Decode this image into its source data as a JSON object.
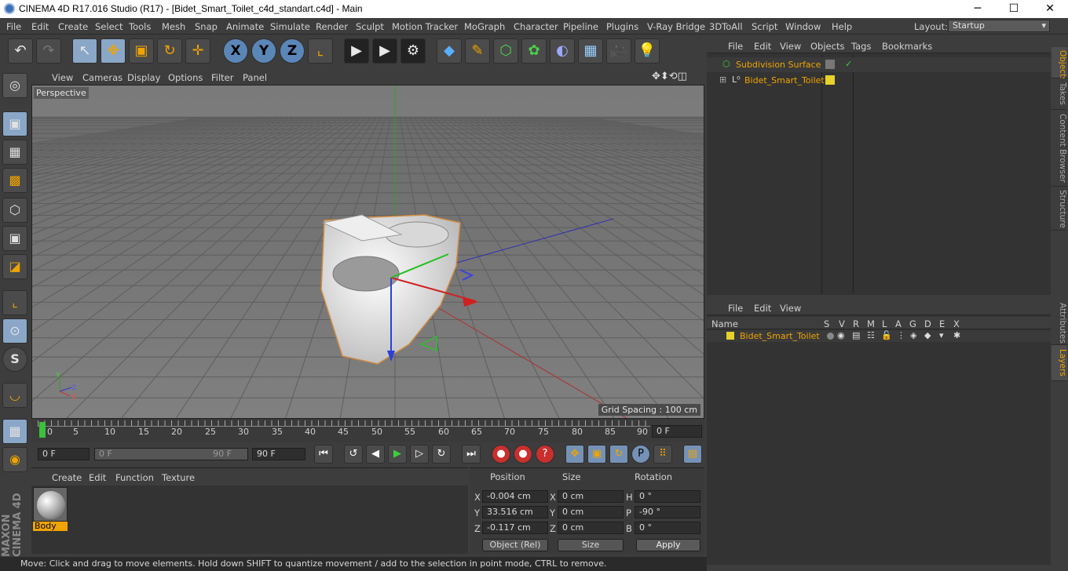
{
  "window": {
    "title": "CINEMA 4D R17.016 Studio (R17) - [Bidet_Smart_Toilet_c4d_standart.c4d] - Main",
    "minimize": "─",
    "maximize": "☐",
    "close": "✕"
  },
  "menu": [
    "File",
    "Edit",
    "Create",
    "Select",
    "Tools",
    "Mesh",
    "Snap",
    "Animate",
    "Simulate",
    "Render",
    "Sculpt",
    "Motion Tracker",
    "MoGraph",
    "Character",
    "Pipeline",
    "Plugins",
    "V-Ray Bridge",
    "3DToAll",
    "Script",
    "Window",
    "Help"
  ],
  "layout": {
    "label": "Layout:",
    "value": "Startup"
  },
  "toolbar": {
    "undo": "↶",
    "redo": "↷",
    "select": "↖",
    "move": "✥",
    "scale": "▣",
    "rotate": "↻",
    "add": "✛",
    "x": "X",
    "y": "Y",
    "z": "Z",
    "coord": "⌞",
    "render_view": "▶",
    "render": "▶",
    "render_settings": "⚙",
    "cube": "◆",
    "pen": "✎",
    "subdiv": "⬡",
    "cloner": "✿",
    "deformer": "◐",
    "floor": "▦",
    "camera": "🎥",
    "light": "💡"
  },
  "left_tools": [
    "◎",
    "▣",
    "▦",
    "▩",
    "⬡",
    "▣",
    "◪",
    "⌞",
    "⊙",
    "S",
    "◡",
    "▦",
    "◉"
  ],
  "viewport": {
    "menu": [
      "View",
      "Cameras",
      "Display",
      "Options",
      "Filter",
      "Panel"
    ],
    "label": "Perspective",
    "grid_spacing": "Grid Spacing : 100 cm",
    "nav": "✥⬍⟲◫"
  },
  "timeline": {
    "ticks": [
      "0",
      "5",
      "10",
      "15",
      "20",
      "25",
      "30",
      "35",
      "40",
      "45",
      "50",
      "55",
      "60",
      "65",
      "70",
      "75",
      "80",
      "85",
      "90"
    ],
    "current": "0 F"
  },
  "transport": {
    "start": "0 F",
    "range_start": "0 F",
    "range_end": "90 F",
    "end": "90 F",
    "buttons": [
      "⏮",
      "↺",
      "◀",
      "▶",
      "▷",
      "↻",
      "⏭"
    ],
    "rec": [
      "●",
      "●",
      "?"
    ],
    "keys": [
      "✥",
      "▣",
      "↻",
      "P",
      "⠿",
      "▤"
    ]
  },
  "materials": {
    "menu": [
      "Create",
      "Edit",
      "Function",
      "Texture"
    ],
    "items": [
      {
        "name": "Body"
      }
    ]
  },
  "coords": {
    "headers": [
      "Position",
      "Size",
      "Rotation"
    ],
    "rows": [
      {
        "pl": "X",
        "pv": "-0.004 cm",
        "sl": "X",
        "sv": "0 cm",
        "rl": "H",
        "rv": "0 °"
      },
      {
        "pl": "Y",
        "pv": "33.516 cm",
        "sl": "Y",
        "sv": "0 cm",
        "rl": "P",
        "rv": "-90 °"
      },
      {
        "pl": "Z",
        "pv": "-0.117 cm",
        "sl": "Z",
        "sv": "0 cm",
        "rl": "B",
        "rv": "0 °"
      }
    ],
    "mode": "Object (Rel)",
    "size_mode": "Size",
    "apply": "Apply"
  },
  "objects": {
    "menu": [
      "File",
      "Edit",
      "View",
      "Objects",
      "Tags",
      "Bookmarks"
    ],
    "items": [
      {
        "name": "Subdivision Surface",
        "check": "✓"
      },
      {
        "name": "Bidet_Smart_Toilet"
      }
    ]
  },
  "layers": {
    "menu": [
      "File",
      "Edit",
      "View"
    ],
    "columns": [
      "Name",
      "S",
      "V",
      "R",
      "M",
      "L",
      "A",
      "G",
      "D",
      "E",
      "X"
    ],
    "item": "Bidet_Smart_Toilet"
  },
  "side_tabs_top": [
    "Objects",
    "Takes",
    "Content Browser",
    "Structure"
  ],
  "side_tabs_bottom": [
    "Attributes",
    "Layers"
  ],
  "status": "Move: Click and drag to move elements. Hold down SHIFT to quantize movement / add to the selection in point mode, CTRL to remove.",
  "brand": "MAXON CINEMA 4D",
  "colors": {
    "accent": "#f0a400",
    "selected_tool": "#8aa7c8"
  }
}
